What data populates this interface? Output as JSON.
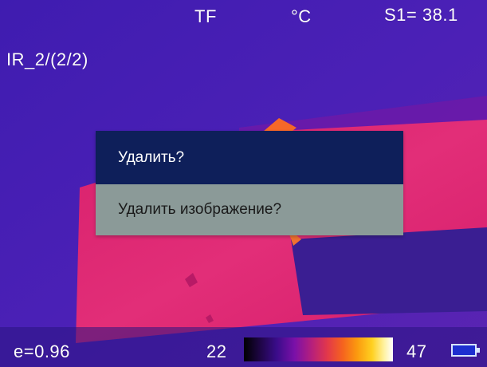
{
  "hud": {
    "mode": "TF",
    "unit": "°C",
    "spot": "S1= 38.1",
    "filename": "IR_2/(2/2)",
    "emissivity": "e=0.96",
    "range_min": "22",
    "range_max": "47"
  },
  "dialog": {
    "title": "Удалить?",
    "message": "Удалить изображение?"
  },
  "colors": {
    "background": "#4a1fb2",
    "dialog_title_bg": "#0e1f5a",
    "dialog_body_bg": "#8b9a98"
  },
  "icons": {
    "battery": "battery-icon",
    "palette": "iron-palette-scale"
  }
}
